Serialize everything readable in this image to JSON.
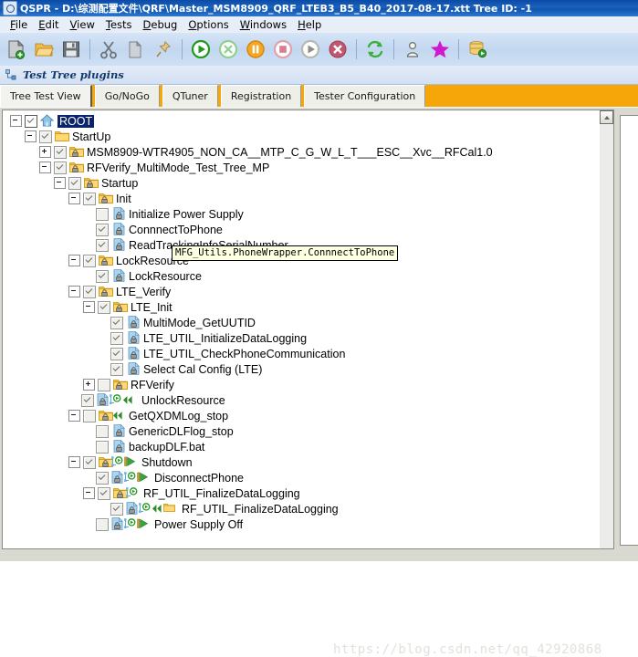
{
  "window": {
    "title": "QSPR - D:\\综测配置文件\\QRF\\Master_MSM8909_QRF_LTEB3_B5_B40_2017-08-17.xtt  Tree ID: -1",
    "logo_icon": "app-icon"
  },
  "menubar": {
    "items": [
      {
        "label": "File"
      },
      {
        "label": "Edit"
      },
      {
        "label": "View"
      },
      {
        "label": "Tests"
      },
      {
        "label": "Debug"
      },
      {
        "label": "Options"
      },
      {
        "label": "Windows"
      },
      {
        "label": "Help"
      }
    ]
  },
  "toolbar": {
    "buttons": [
      {
        "name": "new-file-icon",
        "title": "New"
      },
      {
        "name": "open-folder-icon",
        "title": "Open"
      },
      {
        "name": "save-icon",
        "title": "Save"
      },
      {
        "name": "separator-1",
        "title": ""
      },
      {
        "name": "cut-icon",
        "title": "Cut"
      },
      {
        "name": "copy-icon",
        "title": "Copy"
      },
      {
        "name": "paste-pin-icon",
        "title": "Paste"
      },
      {
        "name": "separator-2",
        "title": ""
      },
      {
        "name": "run-play-icon",
        "title": "Run"
      },
      {
        "name": "abort-x-icon",
        "title": "Abort"
      },
      {
        "name": "pause-icon",
        "title": "Pause"
      },
      {
        "name": "stop-icon",
        "title": "Stop"
      },
      {
        "name": "step-icon",
        "title": "Step"
      },
      {
        "name": "terminate-icon",
        "title": "Terminate"
      },
      {
        "name": "separator-3",
        "title": ""
      },
      {
        "name": "refresh-icon",
        "title": "Refresh"
      },
      {
        "name": "separator-4",
        "title": ""
      },
      {
        "name": "user-icon",
        "title": "User"
      },
      {
        "name": "star-icon",
        "title": "Favorite"
      },
      {
        "name": "separator-5",
        "title": ""
      },
      {
        "name": "database-run-icon",
        "title": "Database"
      }
    ]
  },
  "plugin_header": {
    "title": "Test Tree plugins",
    "icon": "tree-plugin-icon"
  },
  "tabs": [
    {
      "label": "Tree Test View",
      "active": true
    },
    {
      "label": "Go/NoGo",
      "active": false
    },
    {
      "label": "QTuner",
      "active": false
    },
    {
      "label": "Registration",
      "active": false
    },
    {
      "label": "Tester Configuration",
      "active": false
    }
  ],
  "tooltip": {
    "text": "MFG_Utils.PhoneWrapper.ConnnectToPhone"
  },
  "watermark": {
    "text": "https://blog.csdn.net/qq_42920868"
  },
  "colors": {
    "tabstrip_accent": "#f7a60a",
    "selection": "#0a246a",
    "tooltip_bg": "#ffffe1",
    "folder": "#f0b400",
    "titlebar": "#0a4ba8"
  },
  "tree": {
    "rows": [
      {
        "indent": 0,
        "expander": "minus",
        "check": "checked",
        "icon": "home-icon",
        "label": "ROOT",
        "selected": true
      },
      {
        "indent": 1,
        "expander": "minus",
        "check": "checked",
        "icon": "folder-icon",
        "label": "StartUp",
        "selected": false
      },
      {
        "indent": 2,
        "expander": "plus",
        "check": "checked",
        "icon": "folder-lock-icon",
        "label": "MSM8909-WTR4905_NON_CA__MTP_C_G_W_L_T___ESC__Xvc__RFCal1.0",
        "selected": false
      },
      {
        "indent": 2,
        "expander": "minus",
        "check": "checked",
        "icon": "folder-lock-icon",
        "label": "RFVerify_MultiMode_Test_Tree_MP",
        "selected": false
      },
      {
        "indent": 3,
        "expander": "minus",
        "check": "checked",
        "icon": "folder-lock-icon",
        "label": "Startup",
        "selected": false
      },
      {
        "indent": 4,
        "expander": "minus",
        "check": "checked",
        "icon": "folder-lock-icon",
        "label": "Init",
        "selected": false
      },
      {
        "indent": 5,
        "expander": "none",
        "check": "unchecked",
        "icon": "test-lock-icon",
        "label": "Initialize Power Supply",
        "selected": false
      },
      {
        "indent": 5,
        "expander": "none",
        "check": "checked",
        "icon": "test-lock-icon",
        "label": "ConnnectToPhone",
        "selected": false
      },
      {
        "indent": 5,
        "expander": "none",
        "check": "checked",
        "icon": "test-lock-icon",
        "label": "ReadTrackingInfoSerialNumber",
        "selected": false
      },
      {
        "indent": 4,
        "expander": "minus",
        "check": "checked",
        "icon": "folder-lock-icon",
        "label": "LockResource",
        "selected": false
      },
      {
        "indent": 5,
        "expander": "none",
        "check": "checked",
        "icon": "test-lock-icon",
        "label": "LockResource",
        "selected": false
      },
      {
        "indent": 4,
        "expander": "minus",
        "check": "checked",
        "icon": "folder-lock-icon",
        "label": "LTE_Verify",
        "selected": false
      },
      {
        "indent": 5,
        "expander": "minus",
        "check": "checked",
        "icon": "folder-lock-icon",
        "label": "LTE_Init",
        "selected": false
      },
      {
        "indent": 6,
        "expander": "none",
        "check": "checked",
        "icon": "test-lock-icon",
        "label": "MultiMode_GetUUTID",
        "selected": false
      },
      {
        "indent": 6,
        "expander": "none",
        "check": "checked",
        "icon": "test-lock-icon",
        "label": "LTE_UTIL_InitializeDataLogging",
        "selected": false
      },
      {
        "indent": 6,
        "expander": "none",
        "check": "checked",
        "icon": "test-lock-icon",
        "label": "LTE_UTIL_CheckPhoneCommunication",
        "selected": false
      },
      {
        "indent": 6,
        "expander": "none",
        "check": "checked",
        "icon": "test-lock-icon",
        "label": "Select Cal Config (LTE)",
        "selected": false
      },
      {
        "indent": 5,
        "expander": "plus",
        "check": "unchecked",
        "icon": "folder-lock-icon",
        "label": "RFVerify",
        "selected": false
      },
      {
        "indent": 4,
        "expander": "none",
        "check": "checked",
        "icon": "test-link-back-icon",
        "label": "UnlockResource",
        "selected": false
      },
      {
        "indent": 4,
        "expander": "minus",
        "check": "unchecked",
        "icon": "folder-back-icon",
        "label": "GetQXDMLog_stop",
        "selected": false
      },
      {
        "indent": 5,
        "expander": "none",
        "check": "unchecked",
        "icon": "test-lock-icon",
        "label": "GenericDLFlog_stop",
        "selected": false
      },
      {
        "indent": 5,
        "expander": "none",
        "check": "unchecked",
        "icon": "test-lock-icon",
        "label": "backupDLF.bat",
        "selected": false
      },
      {
        "indent": 4,
        "expander": "minus",
        "check": "checked",
        "icon": "folder-run-green-icon",
        "label": "Shutdown",
        "selected": false
      },
      {
        "indent": 5,
        "expander": "none",
        "check": "checked",
        "icon": "test-run-green-icon",
        "label": "DisconnectPhone",
        "selected": false
      },
      {
        "indent": 5,
        "expander": "minus",
        "check": "checked",
        "icon": "folder-run-icon",
        "label": "RF_UTIL_FinalizeDataLogging",
        "selected": false
      },
      {
        "indent": 6,
        "expander": "none",
        "check": "checked",
        "icon": "test-run-back-icon",
        "label": "RF_UTIL_FinalizeDataLogging",
        "selected": false
      },
      {
        "indent": 5,
        "expander": "none",
        "check": "unchecked",
        "icon": "test-run-green-icon",
        "label": "Power Supply Off",
        "selected": false
      }
    ]
  }
}
